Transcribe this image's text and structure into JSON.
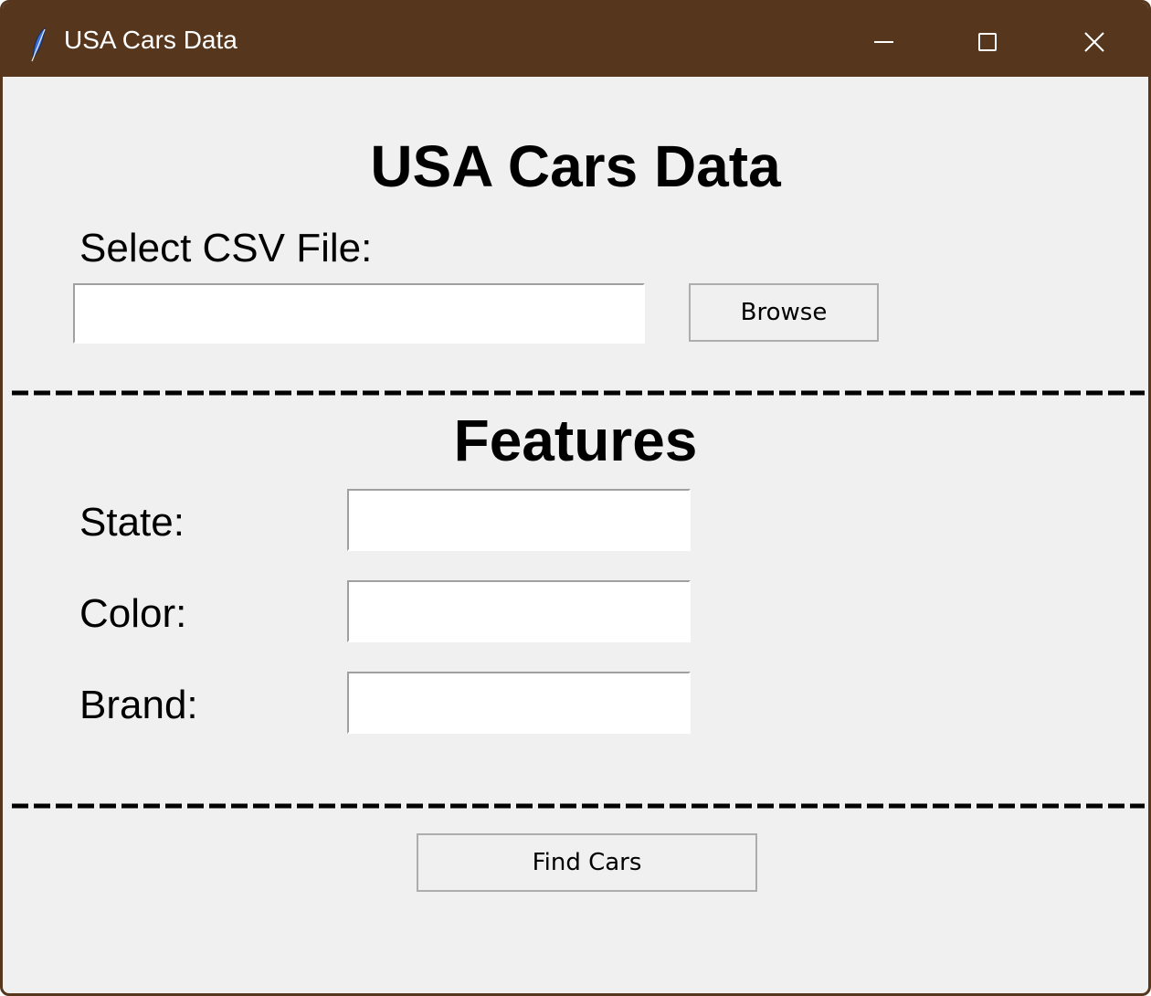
{
  "window": {
    "title": "USA Cars Data",
    "app_icon": "feather-icon",
    "controls": [
      "minimize-icon",
      "maximize-icon",
      "close-icon"
    ],
    "titlebar_color": "#56371e",
    "background_color": "#f0f0f0"
  },
  "main": {
    "title": "USA Cars Data",
    "csv_label": "Select CSV File:",
    "csv_path_value": "",
    "browse_label": "Browse"
  },
  "features": {
    "title": "Features",
    "state_label": "State:",
    "state_value": "",
    "color_label": "Color:",
    "color_value": "",
    "brand_label": "Brand:",
    "brand_value": ""
  },
  "actions": {
    "find_cars_label": "Find Cars"
  }
}
